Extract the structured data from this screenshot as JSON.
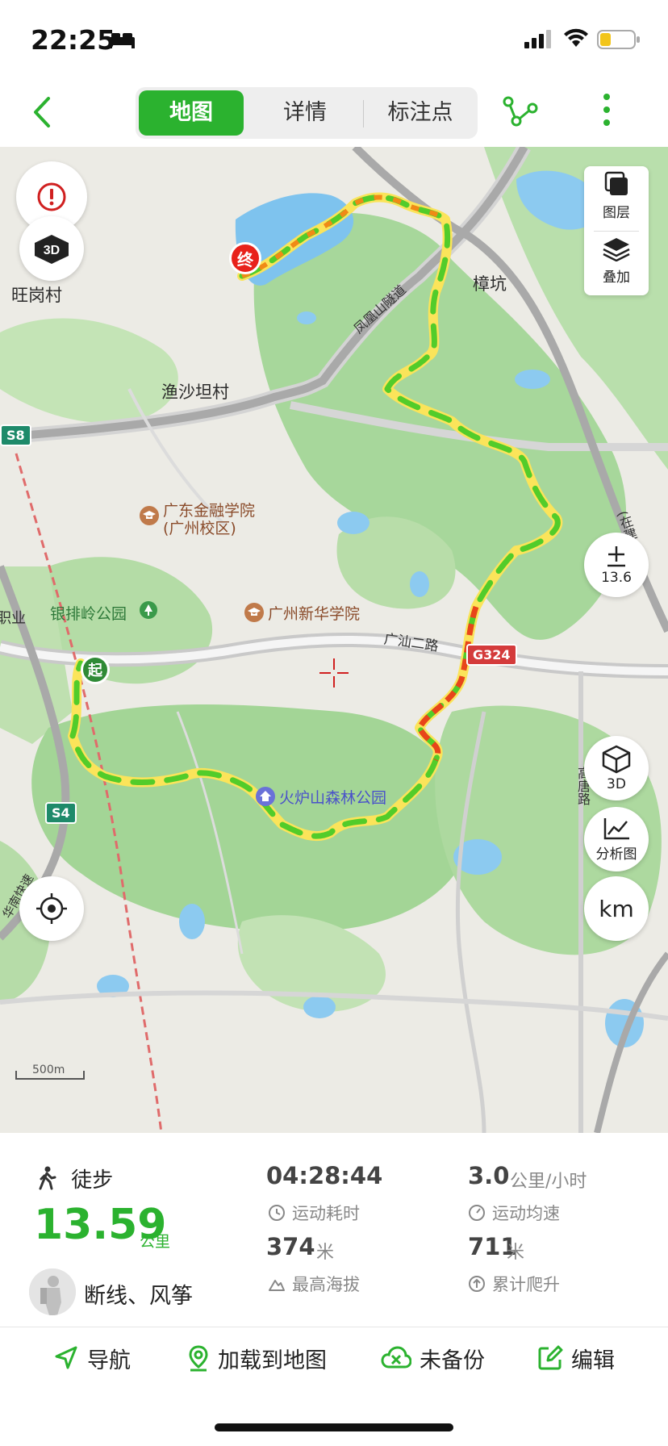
{
  "status_bar": {
    "time": "22:25"
  },
  "nav": {
    "tabs": [
      {
        "label": "地图",
        "active": true
      },
      {
        "label": "详情",
        "active": false
      },
      {
        "label": "标注点",
        "active": false
      }
    ]
  },
  "map": {
    "labels": {
      "wanggang": "旺岗村",
      "zhangkeng": "樟坑",
      "fenghuang_tunnel": "凤凰山隧道",
      "yushatan": "渔沙坦村",
      "gdjr_1": "广东金融学院",
      "gdjr_2": "(广州校区)",
      "yinpailing": "银排岭公园",
      "xinhua": "广州新华学院",
      "guangshan": "广汕二路",
      "huolushan": "火炉山森林公园",
      "gaotang": "高唐路",
      "jichang": "(在建)机场",
      "huanan": "华南快速",
      "zhiye": "职业"
    },
    "road_signs": {
      "s8": "S8",
      "s4": "S4",
      "g324": "G324"
    },
    "markers": {
      "end": "终",
      "start": "起"
    },
    "controls": {
      "layers_label": "图层",
      "overlay_label": "叠加",
      "zoom_level": "13.6",
      "view3d_label": "3D",
      "analysis_label": "分析图",
      "unit_label": "km"
    },
    "scale_label": "500m",
    "route_colors": [
      "#3ccf1e",
      "#a7e01e",
      "#f2d21a",
      "#f08a16",
      "#e8451a"
    ]
  },
  "summary": {
    "sport_type": "徒步",
    "distance": "13.59",
    "distance_unit": "公里",
    "user_name": "断线、风筝",
    "duration": "04:28:44",
    "duration_label": "运动耗时",
    "avg_speed": "3.0",
    "avg_speed_unit": "公里/小时",
    "avg_speed_label": "运动均速",
    "max_altitude": "374",
    "max_altitude_unit": "米",
    "max_altitude_label": "最高海拔",
    "total_climb": "711",
    "total_climb_unit": "米",
    "total_climb_label": "累计爬升"
  },
  "actions": {
    "navigate": "导航",
    "load_to_map": "加载到地图",
    "backup": "未备份",
    "edit": "编辑"
  },
  "colors": {
    "accent": "#2bb22f",
    "end_marker": "#e8221b",
    "start_marker": "#2f8a35"
  }
}
